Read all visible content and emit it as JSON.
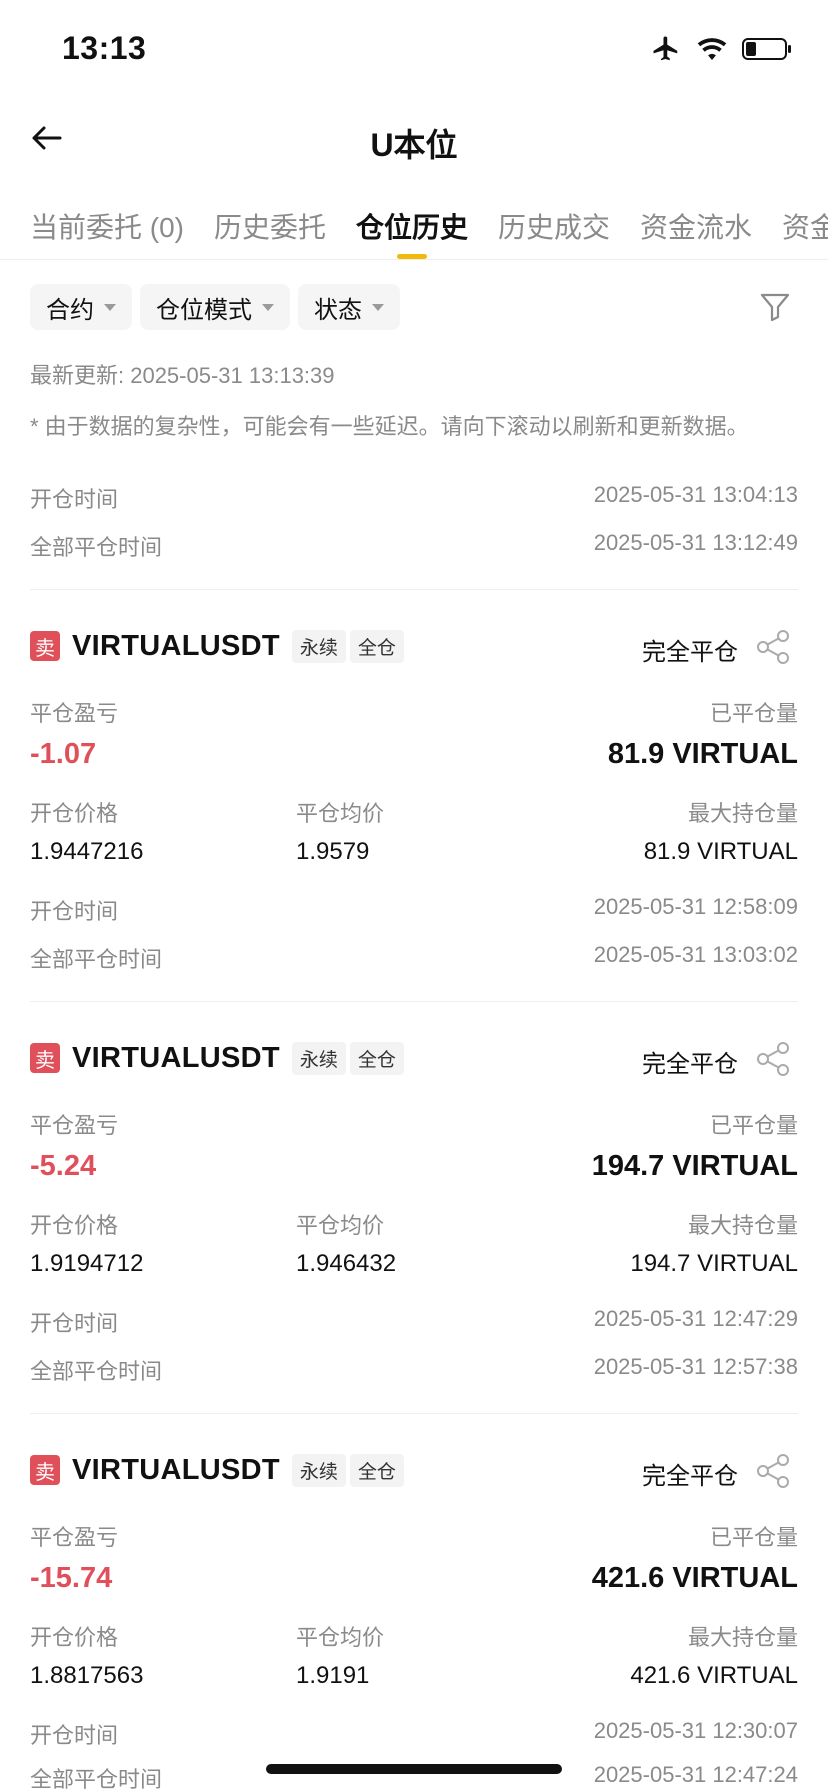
{
  "status_bar": {
    "time": "13:13"
  },
  "nav": {
    "title": "U本位"
  },
  "tabs": [
    {
      "label": "当前委托 (0)"
    },
    {
      "label": "历史委托"
    },
    {
      "label": "仓位历史"
    },
    {
      "label": "历史成交"
    },
    {
      "label": "资金流水"
    },
    {
      "label": "资金"
    }
  ],
  "filters": {
    "contract": "合约",
    "position_mode": "仓位模式",
    "status": "状态"
  },
  "updated": "最新更新: 2025-05-31 13:13:39",
  "notice": "* 由于数据的复杂性，可能会有一些延迟。请向下滚动以刷新和更新数据。",
  "top_partial": {
    "open_time_label": "开仓时间",
    "open_time": "2025-05-31 13:04:13",
    "close_time_label": "全部平仓时间",
    "close_time": "2025-05-31 13:12:49"
  },
  "labels": {
    "pnl": "平仓盈亏",
    "closed_qty": "已平仓量",
    "open_price": "开仓价格",
    "close_avg": "平仓均价",
    "max_pos": "最大持仓量",
    "open_time": "开仓时间",
    "close_time": "全部平仓时间"
  },
  "colors": {
    "accent": "#f0b90b",
    "sell": "#e0505a"
  },
  "cards": [
    {
      "side": "卖",
      "symbol": "VIRTUALUSDT",
      "tag1": "永续",
      "tag2": "全仓",
      "status": "完全平仓",
      "pnl": "-1.07",
      "closed_qty": "81.9 VIRTUAL",
      "open_price": "1.9447216",
      "close_avg": "1.9579",
      "max_pos": "81.9 VIRTUAL",
      "open_time": "2025-05-31 12:58:09",
      "close_time": "2025-05-31 13:03:02"
    },
    {
      "side": "卖",
      "symbol": "VIRTUALUSDT",
      "tag1": "永续",
      "tag2": "全仓",
      "status": "完全平仓",
      "pnl": "-5.24",
      "closed_qty": "194.7 VIRTUAL",
      "open_price": "1.9194712",
      "close_avg": "1.946432",
      "max_pos": "194.7 VIRTUAL",
      "open_time": "2025-05-31 12:47:29",
      "close_time": "2025-05-31 12:57:38"
    },
    {
      "side": "卖",
      "symbol": "VIRTUALUSDT",
      "tag1": "永续",
      "tag2": "全仓",
      "status": "完全平仓",
      "pnl": "-15.74",
      "closed_qty": "421.6 VIRTUAL",
      "open_price": "1.8817563",
      "close_avg": "1.9191",
      "max_pos": "421.6 VIRTUAL",
      "open_time": "2025-05-31 12:30:07",
      "close_time": "2025-05-31 12:47:24"
    }
  ]
}
